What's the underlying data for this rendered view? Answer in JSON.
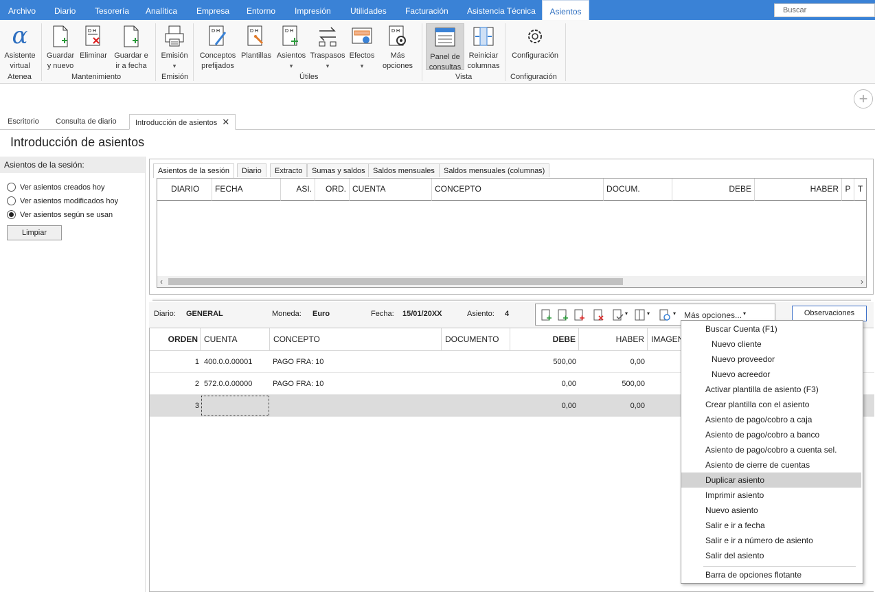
{
  "menubar": {
    "tabs": [
      "Archivo",
      "Diario",
      "Tesorería",
      "Analítica",
      "Empresa",
      "Entorno",
      "Impresión",
      "Utilidades",
      "Facturación",
      "Asistencia Técnica",
      "Asientos"
    ],
    "active_tab": "Asientos",
    "search_placeholder": "Buscar"
  },
  "ribbon": {
    "buttons": {
      "asistente": "Asistente virtual",
      "guardar_nuevo": "Guardar y nuevo",
      "eliminar": "Eliminar",
      "guardar_fecha": "Guardar e ir a fecha",
      "emision": "Emisión",
      "conceptos": "Conceptos prefijados",
      "plantillas": "Plantillas",
      "asientos": "Asientos",
      "traspasos": "Traspasos",
      "efectos": "Efectos",
      "mas_opciones": "Más opciones",
      "panel_consultas": "Panel de consultas",
      "reiniciar": "Reiniciar columnas",
      "configuracion": "Configuración"
    },
    "groups": {
      "atenea": "Atenea",
      "mantenimiento": "Mantenimiento",
      "emision": "Emisión",
      "utiles": "Útiles",
      "vista": "Vista",
      "configuracion": "Configuración"
    }
  },
  "doc_tabs": [
    "Escritorio",
    "Consulta de diario",
    "Introducción de asientos"
  ],
  "page_title": "Introducción de asientos",
  "session": {
    "header": "Asientos de la sesión:",
    "options": [
      "Ver asientos creados hoy",
      "Ver asientos modificados hoy",
      "Ver asientos según se usan"
    ],
    "selected_index": 2,
    "clear_button": "Limpiar"
  },
  "panel": {
    "tabs": [
      "Asientos de la sesión",
      "Diario",
      "Extracto",
      "Sumas y saldos",
      "Saldos mensuales",
      "Saldos mensuales (columnas)"
    ],
    "columns": [
      "DIARIO",
      "FECHA",
      "ASI.",
      "ORD.",
      "CUENTA",
      "CONCEPTO",
      "DOCUM.",
      "DEBE",
      "HABER",
      "P",
      "T"
    ]
  },
  "entry": {
    "diario_label": "Diario:",
    "diario_value": "GENERAL",
    "moneda_label": "Moneda:",
    "moneda_value": "Euro",
    "fecha_label": "Fecha:",
    "fecha_value": "15/01/20XX",
    "asiento_label": "Asiento:",
    "asiento_value": "4",
    "more_options": "Más opciones...",
    "observaciones": "Observaciones"
  },
  "lines": {
    "columns": [
      "ORDEN",
      "CUENTA",
      "CONCEPTO",
      "DOCUMENTO",
      "DEBE",
      "HABER",
      "IMAGEN"
    ],
    "rows": [
      {
        "orden": "1",
        "cuenta": "400.0.0.00001",
        "concepto": "PAGO FRA: 10",
        "documento": "",
        "debe": "500,00",
        "haber": "0,00"
      },
      {
        "orden": "2",
        "cuenta": "572.0.0.00000",
        "concepto": "PAGO FRA: 10",
        "documento": "",
        "debe": "0,00",
        "haber": "500,00"
      },
      {
        "orden": "3",
        "cuenta": "",
        "concepto": "",
        "documento": "",
        "debe": "0,00",
        "haber": "0,00"
      }
    ]
  },
  "context_menu": {
    "items": [
      {
        "label": "Buscar Cuenta (F1)",
        "level": "main"
      },
      {
        "label": "Nuevo cliente",
        "level": "sub"
      },
      {
        "label": "Nuevo proveedor",
        "level": "sub"
      },
      {
        "label": "Nuevo acreedor",
        "level": "sub"
      },
      {
        "label": "Activar plantilla de asiento (F3)",
        "level": "main"
      },
      {
        "label": "Crear plantilla con el asiento",
        "level": "main"
      },
      {
        "label": "Asiento de pago/cobro a caja",
        "level": "main"
      },
      {
        "label": "Asiento de pago/cobro a banco",
        "level": "main"
      },
      {
        "label": "Asiento de pago/cobro a cuenta sel.",
        "level": "main"
      },
      {
        "label": "Asiento de cierre de cuentas",
        "level": "main"
      },
      {
        "label": "Duplicar asiento",
        "level": "main",
        "highlighted": true
      },
      {
        "label": "Imprimir asiento",
        "level": "main"
      },
      {
        "label": "Nuevo asiento",
        "level": "main"
      },
      {
        "label": "Salir e ir a fecha",
        "level": "main"
      },
      {
        "label": "Salir e ir a número de asiento",
        "level": "main"
      },
      {
        "label": "Salir del asiento",
        "level": "main"
      },
      {
        "label": "Barra de opciones flotante",
        "level": "main"
      }
    ]
  },
  "colors": {
    "menubar": "#3a82d6",
    "highlight": "#d3d3d3",
    "accent": "#2e6fc0"
  }
}
